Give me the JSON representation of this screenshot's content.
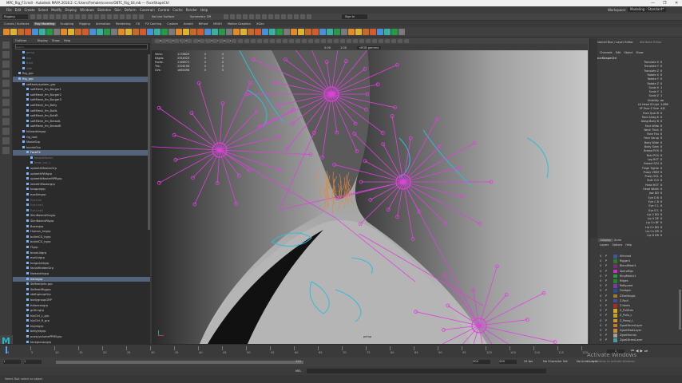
{
  "window": {
    "title": "MPC_Rig_F3.mdl - Autodesk MAYA 2018.2: C:/Users/Female/scenes/OBTC_Rig_04.mb --- FaceShapeCtrl",
    "minimize": "—",
    "maximize": "❐",
    "close": "✕"
  },
  "menubar": {
    "items": [
      "File",
      "Edit",
      "Create",
      "Select",
      "Modify",
      "Display",
      "Windows",
      "Skeleton",
      "Skin",
      "Deform",
      "Constrain",
      "Control",
      "Cache",
      "Render",
      "Help"
    ],
    "workspace_label": "Workspace:",
    "workspace_value": "Modeling - Standard*"
  },
  "statusline": {
    "mode": "Rigging",
    "no_live": "No Live Surface",
    "symmetry": "Symmetry: Off",
    "sign_in": "Sign In"
  },
  "shelf": {
    "tabs": [
      "Curves / Surfaces",
      "Poly Modeling",
      "Sculpting",
      "Rigging",
      "Animation",
      "Rendering",
      "FX",
      "FX Caching",
      "Custom",
      "Arnold",
      "Bifrost",
      "MASH",
      "Motion Graphics",
      "XGen"
    ],
    "active_tab": 1
  },
  "outliner": {
    "menu": [
      "Display",
      "Show",
      "Help"
    ],
    "title": "Outliner",
    "search_placeholder": "Search...",
    "rows": [
      {
        "label": "persp",
        "indent": 2,
        "state": "dim"
      },
      {
        "label": "top",
        "indent": 2,
        "state": "dim"
      },
      {
        "label": "front",
        "indent": 2,
        "state": "dim"
      },
      {
        "label": "side",
        "indent": 2,
        "state": "dim"
      },
      {
        "label": "Rig_grp",
        "indent": 1,
        "state": ""
      },
      {
        "label": "Rig_grp",
        "indent": 1,
        "state": "sel"
      },
      {
        "label": "softbodysystem_grp",
        "indent": 2,
        "state": ""
      },
      {
        "label": "softMesh_fm_Burger1",
        "indent": 3,
        "state": ""
      },
      {
        "label": "softMesh_fm_Burger2",
        "indent": 3,
        "state": ""
      },
      {
        "label": "softMesh_fm_Burger3",
        "indent": 3,
        "state": ""
      },
      {
        "label": "softMesh_fm_Belly",
        "indent": 3,
        "state": ""
      },
      {
        "label": "softMesh_fm_ButtL",
        "indent": 3,
        "state": ""
      },
      {
        "label": "softMesh_fm_ButtR",
        "indent": 3,
        "state": ""
      },
      {
        "label": "softMesh_fm_BreastL",
        "indent": 3,
        "state": ""
      },
      {
        "label": "softMesh_fm_BreastR",
        "indent": 3,
        "state": ""
      },
      {
        "label": "followdhiegrp",
        "indent": 2,
        "state": ""
      },
      {
        "label": "rig_root",
        "indent": 2,
        "state": ""
      },
      {
        "label": "ModelGrp",
        "indent": 2,
        "state": ""
      },
      {
        "label": "InputsGrp",
        "indent": 2,
        "state": ""
      },
      {
        "label": "FaceFX",
        "indent": 3,
        "state": "sel"
      },
      {
        "label": "ebrowMaster",
        "indent": 4,
        "state": "dim"
      },
      {
        "label": "brow_Loc_L",
        "indent": 4,
        "state": "dim"
      },
      {
        "label": "upteethMasterGrp",
        "indent": 3,
        "state": ""
      },
      {
        "label": "upteethPAHgrp",
        "indent": 3,
        "state": ""
      },
      {
        "label": "upteethMasterRPRgrp",
        "indent": 3,
        "state": ""
      },
      {
        "label": "loteethMastergrp",
        "indent": 3,
        "state": ""
      },
      {
        "label": "tonguegrp",
        "indent": 3,
        "state": ""
      },
      {
        "label": "eyeAimgrp",
        "indent": 3,
        "state": ""
      },
      {
        "label": "EyeLine",
        "indent": 3,
        "state": "dim"
      },
      {
        "label": "EyeLine1",
        "indent": 3,
        "state": "dim"
      },
      {
        "label": "EyeLine2",
        "indent": 3,
        "state": "dim"
      },
      {
        "label": "SkinBasicsDrvgrp",
        "indent": 3,
        "state": ""
      },
      {
        "label": "SkinBasicsPAgrp",
        "indent": 3,
        "state": ""
      },
      {
        "label": "Boxergrp",
        "indent": 3,
        "state": ""
      },
      {
        "label": "Human_hrigrp",
        "indent": 3,
        "state": ""
      },
      {
        "label": "bulletCG_hgrp",
        "indent": 3,
        "state": ""
      },
      {
        "label": "bulletCG_hgrp",
        "indent": 3,
        "state": ""
      },
      {
        "label": "Ftgrp",
        "indent": 3,
        "state": ""
      },
      {
        "label": "browLidgrp",
        "indent": 3,
        "state": ""
      },
      {
        "label": "eyeLidgrp",
        "indent": 3,
        "state": ""
      },
      {
        "label": "tongueJntgrp",
        "indent": 3,
        "state": ""
      },
      {
        "label": "facialHiddenGrp",
        "indent": 3,
        "state": ""
      },
      {
        "label": "Noiseskingrp",
        "indent": 3,
        "state": ""
      },
      {
        "label": "extragrp",
        "indent": 3,
        "state": "sel"
      },
      {
        "label": "SkMeshJnts grp",
        "indent": 3,
        "state": ""
      },
      {
        "label": "SkMeshRiggrp",
        "indent": 3,
        "state": ""
      },
      {
        "label": "sbdhgroupGrp",
        "indent": 3,
        "state": ""
      },
      {
        "label": "bodygroupGRP",
        "indent": 3,
        "state": ""
      },
      {
        "label": "fullsecongrp",
        "indent": 3,
        "state": ""
      },
      {
        "label": "gnDrvgrp",
        "indent": 3,
        "state": ""
      },
      {
        "label": "hipCtrl_L_grp",
        "indent": 3,
        "state": ""
      },
      {
        "label": "hipCtrl_R_grp",
        "indent": 3,
        "state": ""
      },
      {
        "label": "hipJntgrp",
        "indent": 3,
        "state": ""
      },
      {
        "label": "bellyJntgrp",
        "indent": 3,
        "state": ""
      },
      {
        "label": "pussyvolumePPMSgrp",
        "indent": 3,
        "state": ""
      },
      {
        "label": "facegroupvgrp",
        "indent": 3,
        "state": ""
      }
    ]
  },
  "viewport": {
    "menu": [
      "View",
      "Shading",
      "Lighting",
      "Show",
      "Renderer",
      "Panels"
    ],
    "hud": [
      {
        "label": "Verts:",
        "v1": "1178829",
        "v2": "0",
        "v3": "0"
      },
      {
        "label": "Edges:",
        "v1": "2354023",
        "v2": "0",
        "v3": "0"
      },
      {
        "label": "Faces:",
        "v1": "1166972",
        "v2": "0",
        "v3": "0"
      },
      {
        "label": "Tris:",
        "v1": "2326196",
        "v2": "0",
        "v3": "0"
      },
      {
        "label": "UVs:",
        "v1": "1665498",
        "v2": "0",
        "v3": "0"
      }
    ],
    "camera_label": "persp",
    "frame_value": "0.00",
    "gamma": "1.00",
    "color_space": "sRGB gamma",
    "colors": {
      "joint": "#e040e0",
      "curve": "#33bbd8",
      "mesh_light": "#a8a8a8",
      "mesh_dark": "#1a1a1a",
      "hair": "#e08a3a"
    }
  },
  "channelbox": {
    "tabs": [
      "Channel Box / Layer Editor",
      "Attribute Editor"
    ],
    "menu": [
      "Channels",
      "Edit",
      "Object",
      "Show"
    ],
    "object": "FaceShapeCtrl",
    "channels": [
      {
        "name": "Translate X",
        "value": "0"
      },
      {
        "name": "Translate Y",
        "value": "0"
      },
      {
        "name": "Translate Z",
        "value": "0"
      },
      {
        "name": "Rotate X",
        "value": "0"
      },
      {
        "name": "Rotate Y",
        "value": "0"
      },
      {
        "name": "Rotate Z",
        "value": "0"
      },
      {
        "name": "Scale X",
        "value": "1"
      },
      {
        "name": "Scale Y",
        "value": "1"
      },
      {
        "name": "Scale Z",
        "value": "1"
      },
      {
        "name": "Visibility",
        "value": "on"
      },
      {
        "name": "Lit Head SCulpt",
        "value": "1.099"
      },
      {
        "name": "SF Face Z Size",
        "value": "4.8"
      },
      {
        "name": "Face Qual B",
        "value": "0"
      },
      {
        "name": "Face Alosg K",
        "value": "0"
      },
      {
        "name": "Alosg Body B",
        "value": "0"
      },
      {
        "name": "Face Wide",
        "value": "0"
      },
      {
        "name": "Neck Thick",
        "value": "0"
      },
      {
        "name": "Face Fku",
        "value": "0"
      },
      {
        "name": "Face Sarup",
        "value": "0"
      },
      {
        "name": "Body Wide",
        "value": "0"
      },
      {
        "name": "Body Slam",
        "value": "0"
      },
      {
        "name": "Breast POS",
        "value": "0"
      },
      {
        "name": "Butt POS",
        "value": "0"
      },
      {
        "name": "Leg ROT",
        "value": "0"
      },
      {
        "name": "Breast SZ4",
        "value": "0"
      },
      {
        "name": "Thigh Tighte",
        "value": "0"
      },
      {
        "name": "Pussy VRIM",
        "value": "0"
      },
      {
        "name": "Pussy SOL",
        "value": "0"
      },
      {
        "name": "Butt CL5",
        "value": "0"
      },
      {
        "name": "Head ROT",
        "value": "0"
      },
      {
        "name": "Head Width",
        "value": "0"
      },
      {
        "name": "Jaw DD",
        "value": "0"
      },
      {
        "name": "Eye D B",
        "value": "0"
      },
      {
        "name": "Eye C B",
        "value": "0"
      },
      {
        "name": "Eye C L",
        "value": "0"
      },
      {
        "name": "Eye D L",
        "value": "0"
      },
      {
        "name": "Lip U DD",
        "value": "0"
      },
      {
        "name": "Lip U DE",
        "value": "0"
      },
      {
        "name": "Lip Cn BF",
        "value": "0"
      },
      {
        "name": "Lip Cn DD",
        "value": "0"
      },
      {
        "name": "Lip Cn DR",
        "value": "0"
      },
      {
        "name": "Lip D DR",
        "value": "0"
      }
    ]
  },
  "layers": {
    "tabs": [
      "Display",
      "Anim"
    ],
    "menu": [
      "Layers",
      "Options",
      "Help"
    ],
    "items": [
      {
        "label": "Mirrored",
        "color": "#3a5a9a"
      },
      {
        "label": "Rigger1",
        "color": "#2a7a2a"
      },
      {
        "label": "BlendMesh1",
        "color": "#7a2a7a"
      },
      {
        "label": "SperoRigs",
        "color": "#c830c8"
      },
      {
        "label": "RingMatrix1",
        "color": "#2a9a3a"
      },
      {
        "label": "Rdges",
        "color": "#1a8a2a"
      },
      {
        "label": "Refigured",
        "color": "#7a3aaa"
      },
      {
        "label": "Fivetgon",
        "color": "#2a4a9a"
      },
      {
        "label": "ZZsettingsL",
        "color": "#aa7a1a"
      },
      {
        "label": "Z-Facil",
        "color": "#4a4a9a"
      },
      {
        "label": "Z-Heels",
        "color": "#aa2a2a"
      },
      {
        "label": "Z_PullExts",
        "color": "#ddaa1a"
      },
      {
        "label": "Z_Pulls_L",
        "color": "#c8a020"
      },
      {
        "label": "Z_Parog_L",
        "color": "#d09a20"
      },
      {
        "label": "ZgsetFacesLayer",
        "color": "#c87a2a"
      },
      {
        "label": "ZgsetMastLayer",
        "color": "#c88a3a"
      },
      {
        "label": "ZgsetHornsL",
        "color": "#a0a0a0"
      },
      {
        "label": "ZgsetDressLayer",
        "color": "#4a9aaa"
      }
    ]
  },
  "timeline": {
    "ticks": [
      "0",
      "5",
      "10",
      "15",
      "20",
      "25",
      "30",
      "35",
      "40",
      "45",
      "50",
      "55",
      "60",
      "65",
      "70",
      "75",
      "80",
      "85",
      "90",
      "95",
      "100",
      "105",
      "110",
      "115",
      "120"
    ],
    "current_frame": "1"
  },
  "range": {
    "start": "1",
    "inner_start": "1",
    "inner_end": "120",
    "end": "200",
    "max": "200",
    "fps": "24 fps",
    "character_set": "No Character Set",
    "anim_layer": "No Anim Layer"
  },
  "mel": {
    "label": "MEL"
  },
  "help": {
    "text": "Select Tool: select an object"
  },
  "watermark": {
    "title": "Activate Windows",
    "sub": "Go to Settings to activate Windows."
  },
  "logo": {
    "letter": "M"
  }
}
